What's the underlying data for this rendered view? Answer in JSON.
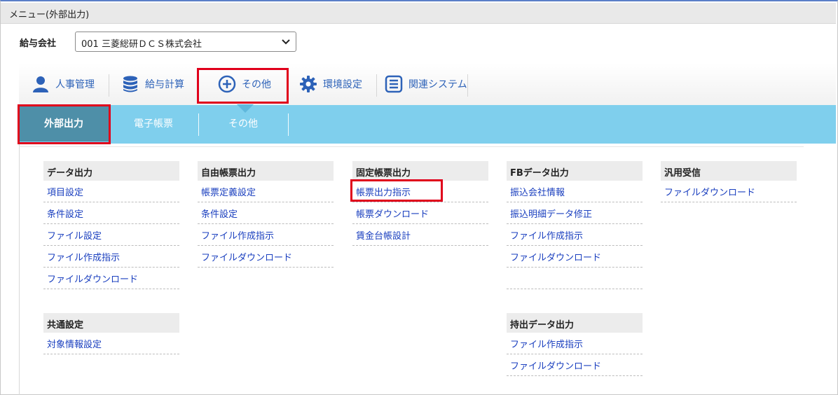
{
  "window": {
    "title": "メニュー(外部出力)"
  },
  "company": {
    "label": "給与会社",
    "selected": "001 三菱総研ＤＣＳ株式会社"
  },
  "main_tabs": [
    {
      "label": "人事管理",
      "icon": "person-icon"
    },
    {
      "label": "給与計算",
      "icon": "database-icon"
    },
    {
      "label": "その他",
      "icon": "plus-circle-icon"
    },
    {
      "label": "環境設定",
      "icon": "gear-icon"
    },
    {
      "label": "関連システム",
      "icon": "list-icon"
    }
  ],
  "sub_tabs": [
    {
      "label": "外部出力"
    },
    {
      "label": "電子帳票"
    },
    {
      "label": "その他"
    }
  ],
  "sections": {
    "data_output": {
      "title": "データ出力",
      "items": [
        "項目設定",
        "条件設定",
        "ファイル設定",
        "ファイル作成指示",
        "ファイルダウンロード"
      ]
    },
    "free_form": {
      "title": "自由帳票出力",
      "items": [
        "帳票定義設定",
        "条件設定",
        "ファイル作成指示",
        "ファイルダウンロード"
      ]
    },
    "fixed_form": {
      "title": "固定帳票出力",
      "items": [
        "帳票出力指示",
        "帳票ダウンロード",
        "賃金台帳設計"
      ]
    },
    "fb_data": {
      "title": "FBデータ出力",
      "items": [
        "振込会社情報",
        "振込明細データ修正",
        "ファイル作成指示",
        "ファイルダウンロード"
      ]
    },
    "general_receive": {
      "title": "汎用受信",
      "items": [
        "ファイルダウンロード"
      ]
    },
    "common_settings": {
      "title": "共通設定",
      "items": [
        "対象情報設定"
      ]
    },
    "carry_out": {
      "title": "持出データ出力",
      "items": [
        "ファイル作成指示",
        "ファイルダウンロード"
      ]
    }
  },
  "colors": {
    "accent": "#2d62b8",
    "subbar": "#7fcfed",
    "active_subtab": "#4e8fa8",
    "highlight": "#e0001b",
    "link": "#1a3fbf"
  }
}
